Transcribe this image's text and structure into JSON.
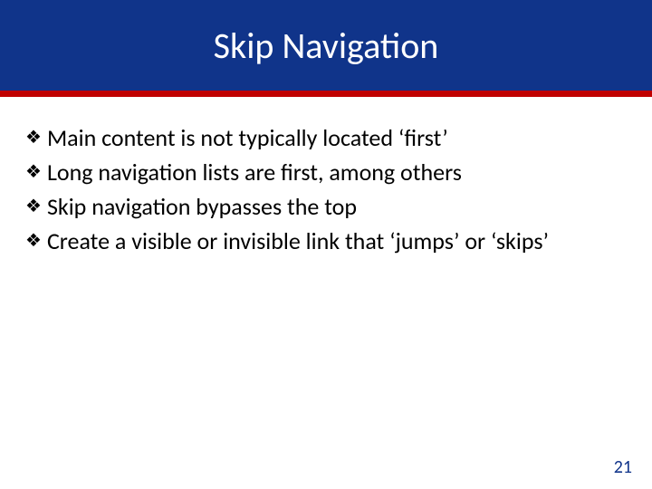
{
  "title": "Skip Navigation",
  "bullets": [
    "Main content is not typically located ‘first’",
    "Long navigation lists are first, among others",
    "Skip navigation bypasses the top",
    "Create a visible or invisible link that ‘jumps’ or ‘skips’"
  ],
  "page_number": "21"
}
